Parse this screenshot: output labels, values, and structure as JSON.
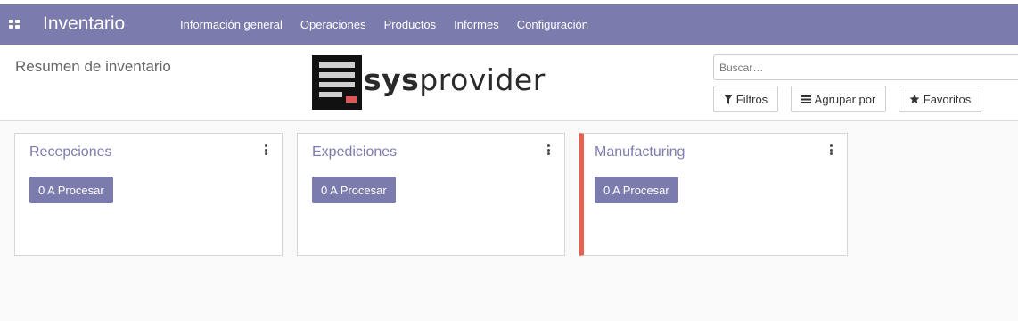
{
  "app": {
    "title": "Inventario"
  },
  "navbar": {
    "menu": [
      {
        "label": "Información general"
      },
      {
        "label": "Operaciones"
      },
      {
        "label": "Productos"
      },
      {
        "label": "Informes"
      },
      {
        "label": "Configuración"
      }
    ],
    "colors": {
      "background": "#7c7bad",
      "text": "#ffffff"
    }
  },
  "control_panel": {
    "breadcrumb": "Resumen de inventario",
    "logo": {
      "text_bold": "sys",
      "text_regular": "provider"
    },
    "search": {
      "placeholder": "Buscar…",
      "value": ""
    },
    "filters_label": "Filtros",
    "groupby_label": "Agrupar por",
    "favorites_label": "Favoritos"
  },
  "cards": [
    {
      "title": "Recepciones",
      "button_label": "0 A Procesar",
      "accent": false
    },
    {
      "title": "Expediciones",
      "button_label": "0 A Procesar",
      "accent": false
    },
    {
      "title": "Manufacturing",
      "button_label": "0 A Procesar",
      "accent": true,
      "accent_color": "#e9604f"
    }
  ],
  "icons": {
    "apps": "grid-icon",
    "filter": "filter-icon",
    "groupby": "list-icon",
    "favorites": "star-icon",
    "card_menu": "kebab-menu-icon"
  }
}
